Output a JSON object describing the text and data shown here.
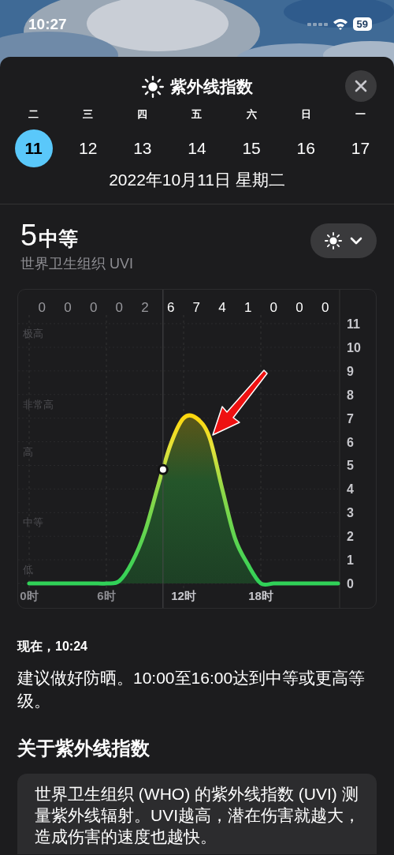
{
  "status_bar": {
    "time": "10:27",
    "battery": "59"
  },
  "sheet": {
    "title": "紫外线指数"
  },
  "days": [
    {
      "weekday": "二",
      "date": "11",
      "selected": true
    },
    {
      "weekday": "三",
      "date": "12",
      "selected": false
    },
    {
      "weekday": "四",
      "date": "13",
      "selected": false
    },
    {
      "weekday": "五",
      "date": "14",
      "selected": false
    },
    {
      "weekday": "六",
      "date": "15",
      "selected": false
    },
    {
      "weekday": "日",
      "date": "16",
      "selected": false
    },
    {
      "weekday": "一",
      "date": "17",
      "selected": false
    }
  ],
  "date_line": "2022年10月11日 星期二",
  "current": {
    "value": "5",
    "category": "中等",
    "source": "世界卫生组织 UVI"
  },
  "chart": {
    "hourly_peaks": [
      {
        "value": "0",
        "past": true
      },
      {
        "value": "0",
        "past": true
      },
      {
        "value": "0",
        "past": true
      },
      {
        "value": "0",
        "past": true
      },
      {
        "value": "2",
        "past": true
      },
      {
        "value": "6",
        "past": false
      },
      {
        "value": "7",
        "past": false
      },
      {
        "value": "4",
        "past": false
      },
      {
        "value": "1",
        "past": false
      },
      {
        "value": "0",
        "past": false
      },
      {
        "value": "0",
        "past": false
      },
      {
        "value": "0",
        "past": false
      }
    ],
    "band_labels": [
      "极高",
      "非常高",
      "高",
      "中等",
      "低"
    ],
    "chart_data": {
      "type": "area",
      "x": [
        0,
        1,
        2,
        3,
        4,
        5,
        6,
        7,
        8,
        9,
        10,
        11,
        12,
        13,
        14,
        15,
        16,
        17,
        18,
        19,
        20,
        21,
        22,
        23,
        24
      ],
      "series": [
        {
          "color": "#30d158",
          "values": [
            0,
            0,
            0,
            0,
            0,
            0,
            0,
            0.1,
            0.9,
            2.2,
            4.1,
            5.9,
            7.0,
            7.0,
            6.2,
            4.0,
            1.9,
            0.8,
            0,
            0,
            0,
            0,
            0,
            0,
            0
          ]
        }
      ],
      "grid": true,
      "xlim": [
        0,
        24
      ],
      "ylim": [
        0,
        11
      ],
      "xticks": [
        {
          "value": 0,
          "label": "0时"
        },
        {
          "value": 6,
          "label": "6时"
        },
        {
          "value": 12,
          "label": "12时"
        },
        {
          "value": 18,
          "label": "18时"
        }
      ],
      "yticks": [
        0,
        1,
        2,
        3,
        4,
        5,
        6,
        7,
        8,
        9,
        10,
        11
      ],
      "ref_lines": [
        {
          "axis": "x",
          "value": 10.4
        }
      ]
    }
  },
  "now": {
    "label": "现在，10:24",
    "advice": "建议做好防晒。10:00至16:00达到中等或更高等级。"
  },
  "about": {
    "heading": "关于紫外线指数",
    "text": "世界卫生组织 (WHO) 的紫外线指数 (UVI) 测量紫外线辐射。UVI越高，潜在伤害就越大，造成伤害的速度也越快。"
  }
}
